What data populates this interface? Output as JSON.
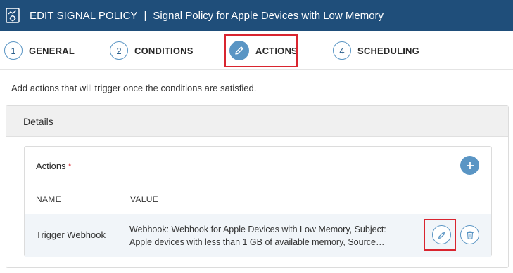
{
  "header": {
    "icon": "policy-chart-icon",
    "title": "EDIT SIGNAL POLICY",
    "separator": "|",
    "subtitle": "Signal Policy for Apple Devices with Low Memory"
  },
  "stepper": {
    "steps": [
      {
        "number": "1",
        "label": "GENERAL",
        "active": false
      },
      {
        "number": "2",
        "label": "CONDITIONS",
        "active": false
      },
      {
        "number": "",
        "label": "ACTIONS",
        "active": true,
        "icon": "pencil-icon"
      },
      {
        "number": "4",
        "label": "SCHEDULING",
        "active": false
      }
    ]
  },
  "description": "Add actions that will trigger once the conditions are satisfied.",
  "details": {
    "title": "Details",
    "actions": {
      "title": "Actions",
      "required_mark": "*",
      "add_icon": "plus-icon",
      "columns": {
        "name": "NAME",
        "value": "VALUE"
      },
      "rows": [
        {
          "name": "Trigger Webhook",
          "value_line1": "Webhook: Webhook for Apple Devices with Low Memory, Subject:",
          "value_line2": "Apple devices with less than 1 GB of available memory, Source…",
          "edit_icon": "pencil-icon",
          "delete_icon": "trash-icon"
        }
      ]
    }
  },
  "colors": {
    "header_bg": "#1f4e7a",
    "accent": "#5a95c4",
    "highlight": "#d9252f"
  }
}
